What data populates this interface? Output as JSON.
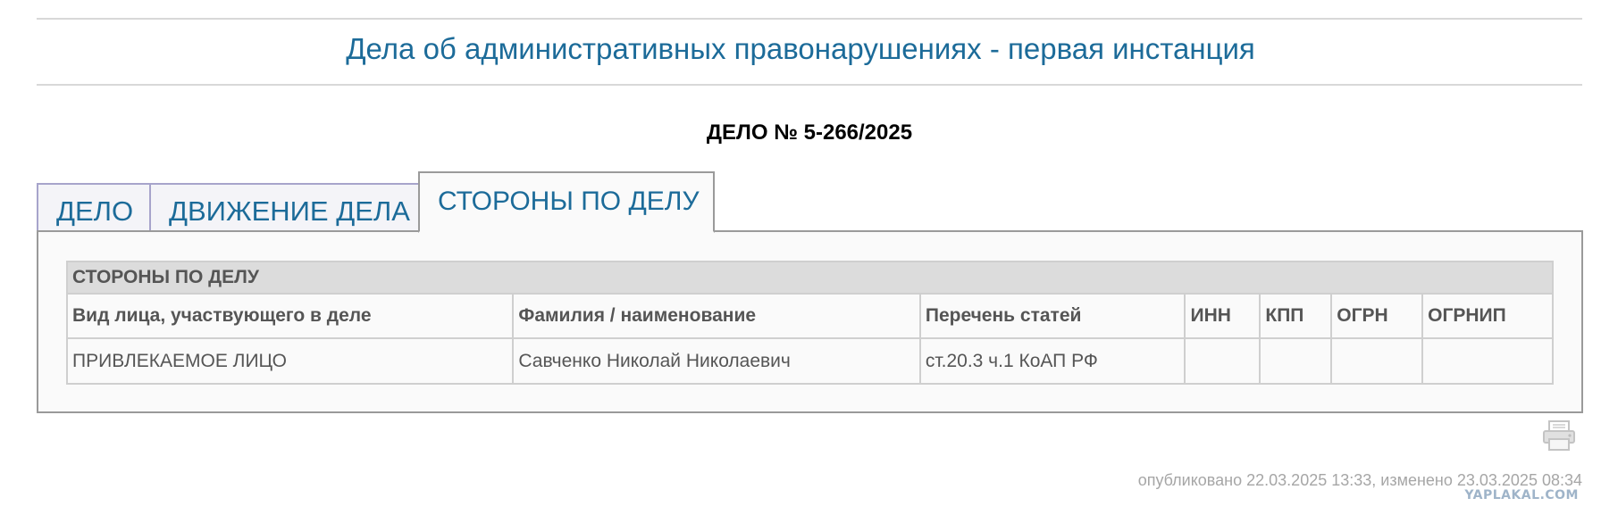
{
  "header": {
    "court_title": "Дела об административных правонарушениях - первая инстанция"
  },
  "case": {
    "number": "ДЕЛО № 5-266/2025"
  },
  "tabs": [
    {
      "label": "ДЕЛО",
      "active": false
    },
    {
      "label": "ДВИЖЕНИЕ ДЕЛА",
      "active": false
    },
    {
      "label": "СТОРОНЫ ПО ДЕЛУ",
      "active": true
    }
  ],
  "parties": {
    "caption": "СТОРОНЫ ПО ДЕЛУ",
    "columns": [
      "Вид лица, участвующего в деле",
      "Фамилия / наименование",
      "Перечень статей",
      "ИНН",
      "КПП",
      "ОГРН",
      "ОГРНИП"
    ],
    "rows": [
      [
        "ПРИВЛЕКАЕМОЕ ЛИЦО",
        "Савченко Николай Николаевич",
        "ст.20.3 ч.1 КоАП РФ",
        "",
        "",
        "",
        ""
      ]
    ]
  },
  "icons": {
    "print": "printer-icon"
  },
  "footer": {
    "published": "опубликовано 22.03.2025 13:33, изменено 23.03.2025 08:34",
    "watermark": "YAPLAKAL.COM"
  },
  "colors": {
    "title": "#1c6b99",
    "tab_border": "#a7a4cb",
    "header_bg": "#dcdcdc",
    "muted_text": "#a6a6a6"
  }
}
